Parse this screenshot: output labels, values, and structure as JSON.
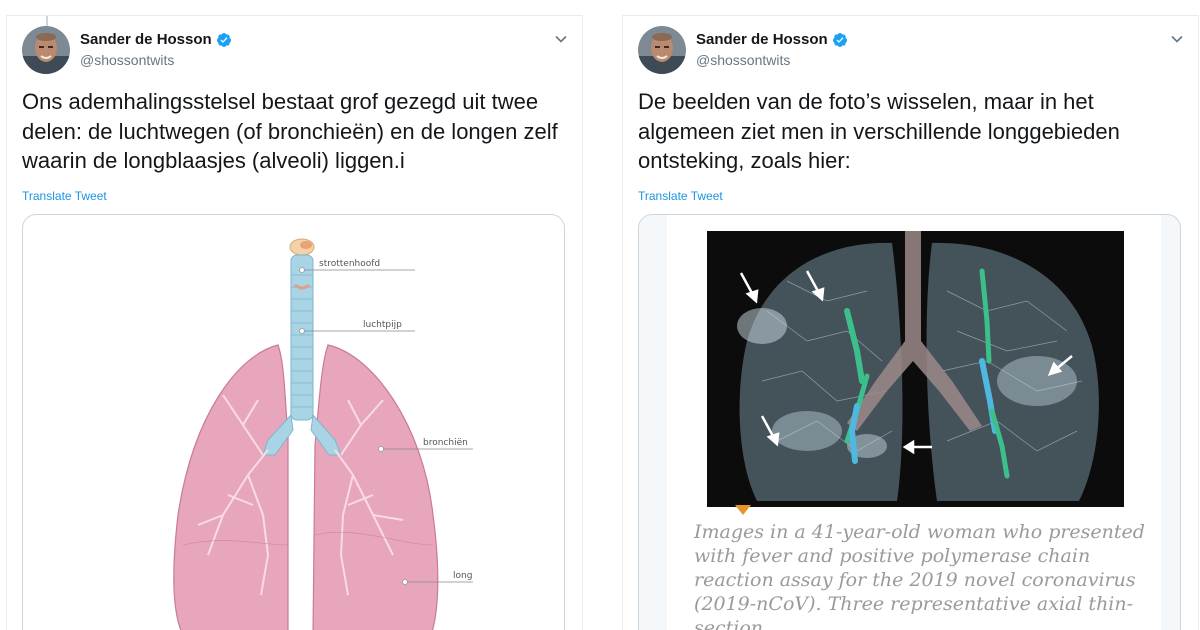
{
  "tweets": [
    {
      "author": {
        "name": "Sander de Hosson",
        "handle": "@shossontwits",
        "verified": true
      },
      "text": "Ons ademhalingsstelsel bestaat grof gezegd uit twee delen: de luchtwegen (of bronchieën) en de longen zelf waarin de longblaasjes (alveoli) liggen.i",
      "translate_label": "Translate Tweet",
      "media": {
        "type": "lung-diagram",
        "labels": {
          "larynx": "strottenhoofd",
          "trachea": "luchtpijp",
          "bronchi": "bronchiën",
          "lung": "long"
        }
      }
    },
    {
      "author": {
        "name": "Sander de Hosson",
        "handle": "@shossontwits",
        "verified": true
      },
      "text": "De beelden van de foto’s wisselen, maar in het algemeen ziet men in verschillende longgebieden ontsteking, zoals hier:",
      "translate_label": "Translate Tweet",
      "media": {
        "type": "ct-scan-figure",
        "caption": "Images in a 41-year-old woman who presented with fever and positive polymerase chain reaction assay for the 2019 novel coronavirus (2019-nCoV). Three representative axial thin-section"
      }
    }
  ],
  "icons": [
    "avatar",
    "verified-badge-icon",
    "chevron-down-icon",
    "arrow-icon"
  ],
  "colors": {
    "link": "#1b95e0",
    "verified": "#1da1f2",
    "secondary": "#657786",
    "lung": "#e8a6bd",
    "airway": "#a8d4e6"
  }
}
